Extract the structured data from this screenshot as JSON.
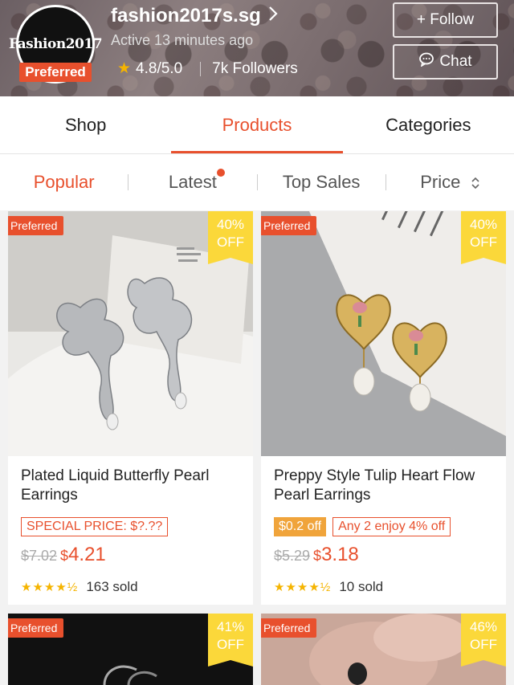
{
  "shop": {
    "avatar_text": "Fashion2017",
    "preferred": "Preferred",
    "name": "fashion2017s.sg",
    "active": "Active 13 minutes ago",
    "rating": "4.8/5.0",
    "followers": "7k Followers",
    "follow_label": "+ Follow",
    "chat_label": "Chat"
  },
  "tabs": [
    {
      "label": "Shop",
      "active": false
    },
    {
      "label": "Products",
      "active": true
    },
    {
      "label": "Categories",
      "active": false
    }
  ],
  "sort": [
    {
      "label": "Popular",
      "active": true
    },
    {
      "label": "Latest",
      "dot": true
    },
    {
      "label": "Top Sales"
    },
    {
      "label": "Price",
      "icon": "sort-updown-icon"
    }
  ],
  "products": [
    {
      "preferred": "Preferred",
      "discount_pct": "40%",
      "discount_word": "OFF",
      "title": "Plated Liquid Butterfly Pearl Earrings",
      "promo_outline": "SPECIAL PRICE: $?.??",
      "old_price": "$7.02",
      "currency": "$",
      "price": "4.21",
      "sold": "163 sold",
      "stars": "★★★★½"
    },
    {
      "preferred": "Preferred",
      "discount_pct": "40%",
      "discount_word": "OFF",
      "title": "Preppy Style Tulip Heart Flow Pearl Earrings",
      "promo_fill": "$0.2 off",
      "promo_outline": "Any 2 enjoy 4% off",
      "old_price": "$5.29",
      "currency": "$",
      "price": "3.18",
      "sold": "10 sold",
      "stars": "★★★★½"
    },
    {
      "preferred": "Preferred",
      "discount_pct": "41%",
      "discount_word": "OFF"
    },
    {
      "preferred": "Preferred",
      "discount_pct": "46%",
      "discount_word": "OFF"
    }
  ],
  "colors": {
    "accent": "#e8502d",
    "star": "#f5b400",
    "off_tag": "#fbd83a",
    "promo_fill": "#f0a43b"
  }
}
